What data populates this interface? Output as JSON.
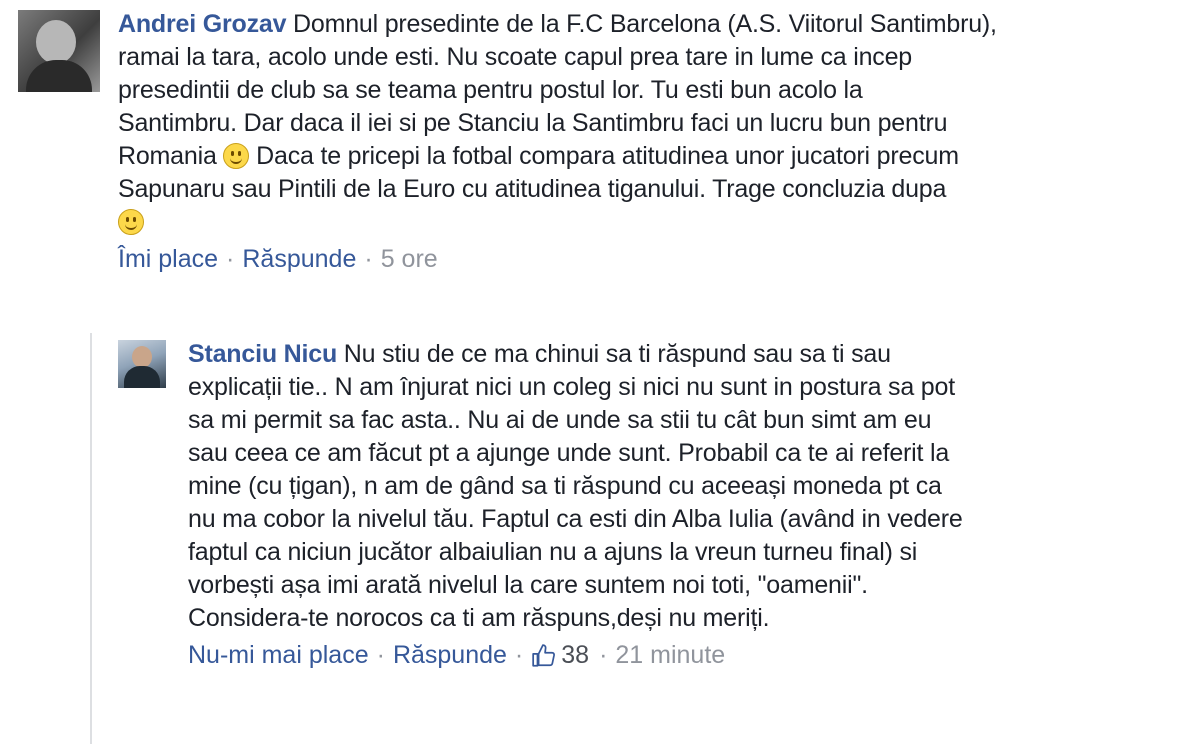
{
  "comments": [
    {
      "author": "Andrei Grozav",
      "text_lines": [
        "Domnul presedinte de la F.C Barcelona (A.S. Viitorul Santimbru),",
        "ramai la tara, acolo unde esti. Nu scoate capul prea tare in lume ca incep",
        "presedintii de club sa se teama pentru postul lor. Tu esti bun acolo la",
        "Santimbru. Dar daca il iei si pe Stanciu la Santimbru faci un lucru bun pentru"
      ],
      "text_part_a": "Romania",
      "text_part_b": "Daca te pricepi la fotbal compara atitudinea unor jucatori precum",
      "text_line_6": "Sapunaru sau Pintili de la Euro cu atitudinea tiganului. Trage concluzia dupa",
      "emoji": "smiley-icon",
      "actions": {
        "like": "Îmi place",
        "separator": "·",
        "reply": "Răspunde",
        "time": "5 ore"
      }
    },
    {
      "author": "Stanciu Nicu",
      "text_first": "Nu stiu de ce ma chinui sa ti răspund sau sa ti sau",
      "text_lines": [
        "explicații tie.. N am înjurat nici un coleg si nici nu sunt in postura sa pot",
        "sa mi permit sa fac asta.. Nu ai de unde sa stii tu cât bun simt am eu",
        "sau ceea ce am făcut pt a ajunge unde sunt. Probabil ca te ai referit la",
        "mine (cu țigan), n am de gând sa ti răspund cu aceeași moneda pt ca",
        "nu ma cobor la nivelul tău. Faptul ca esti din Alba Iulia (având in vedere",
        "faptul ca niciun jucător albaiulian nu a ajuns la vreun turneu final) si",
        "vorbești așa imi arată nivelul la care suntem noi toti, \"oamenii\".",
        "Considera-te norocos ca ti am răspuns,deși nu meriți."
      ],
      "actions": {
        "unlike": "Nu-mi mai place",
        "separator": "·",
        "reply": "Răspunde",
        "like_icon": "thumbs-up-icon",
        "like_count": "38",
        "time": "21 minute"
      }
    }
  ],
  "colors": {
    "link": "#365899",
    "text": "#1d2129",
    "meta": "#90949c"
  }
}
